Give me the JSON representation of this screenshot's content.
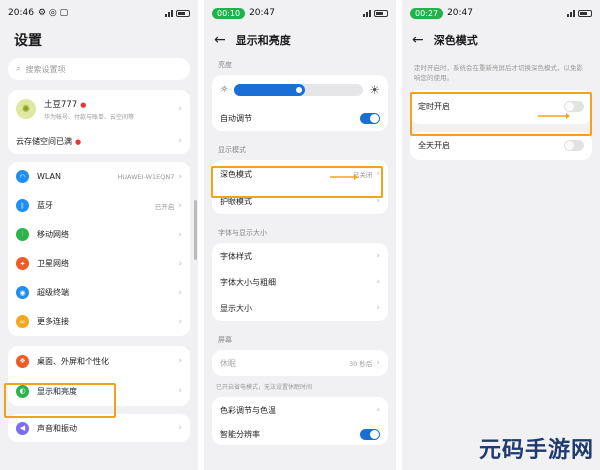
{
  "panel1": {
    "status": {
      "time": "20:46",
      "battery": "76"
    },
    "title": "设置",
    "search_placeholder": "搜索设置项",
    "account": {
      "name": "土豆777",
      "subtitle": "华为帐号、付款与账单、云空间等",
      "cloud": "云存储空间已满"
    },
    "network_items": [
      {
        "label": "WLAN",
        "value": "HUAWEI-W1EQN7",
        "color": "#1e8ef0",
        "icon": "wifi-icon"
      },
      {
        "label": "蓝牙",
        "value": "已开启",
        "color": "#1e8ef0",
        "icon": "bluetooth-icon"
      },
      {
        "label": "移动网络",
        "color": "#2cb34a",
        "icon": "signal-icon"
      },
      {
        "label": "卫星网络",
        "color": "#f05a24",
        "icon": "satellite-icon"
      },
      {
        "label": "超级终端",
        "color": "#1e8ef0",
        "icon": "super-device-icon"
      },
      {
        "label": "更多连接",
        "color": "#f5a623",
        "icon": "link-icon"
      }
    ],
    "display_items": [
      {
        "label": "桌面、外屏和个性化",
        "color": "#f05a24",
        "icon": "palette-icon"
      },
      {
        "label": "显示和亮度",
        "color": "#2cb34a",
        "icon": "display-icon"
      }
    ],
    "sound_item": {
      "label": "声音和振动",
      "color": "#7c6cf0"
    }
  },
  "panel2": {
    "status": {
      "time": "20:47",
      "pill": "00:10",
      "battery": "76"
    },
    "title": "显示和亮度",
    "brightness_section": "亮度",
    "brightness_level": 0.55,
    "auto_adjust": "自动调节",
    "display_mode_section": "显示模式",
    "dark_mode": {
      "label": "深色模式",
      "value": "已关闭"
    },
    "eye_comfort": "护眼模式",
    "font_section": "字体与显示大小",
    "font_items": [
      "字体样式",
      "字体大小与粗细",
      "显示大小"
    ],
    "screen_section": "屏幕",
    "sleep": {
      "label": "休眠",
      "value": "30 秒后"
    },
    "sleep_note": "已开启省电模式，无法设置休眠时间",
    "color_item": "色彩调节与色温",
    "smart_resolution": "智能分辨率"
  },
  "panel3": {
    "status": {
      "time": "20:47",
      "pill": "00:27",
      "battery": "76"
    },
    "title": "深色模式",
    "description": "定时开启时，系统会在重新亮屏后才切换深色模式，以免影响您的使用。",
    "scheduled": "定时开启",
    "all_day": "全天开启"
  },
  "watermark": "元码手游网",
  "colors": {
    "highlight": "#f2a31b",
    "accent": "#1a6fd6"
  }
}
